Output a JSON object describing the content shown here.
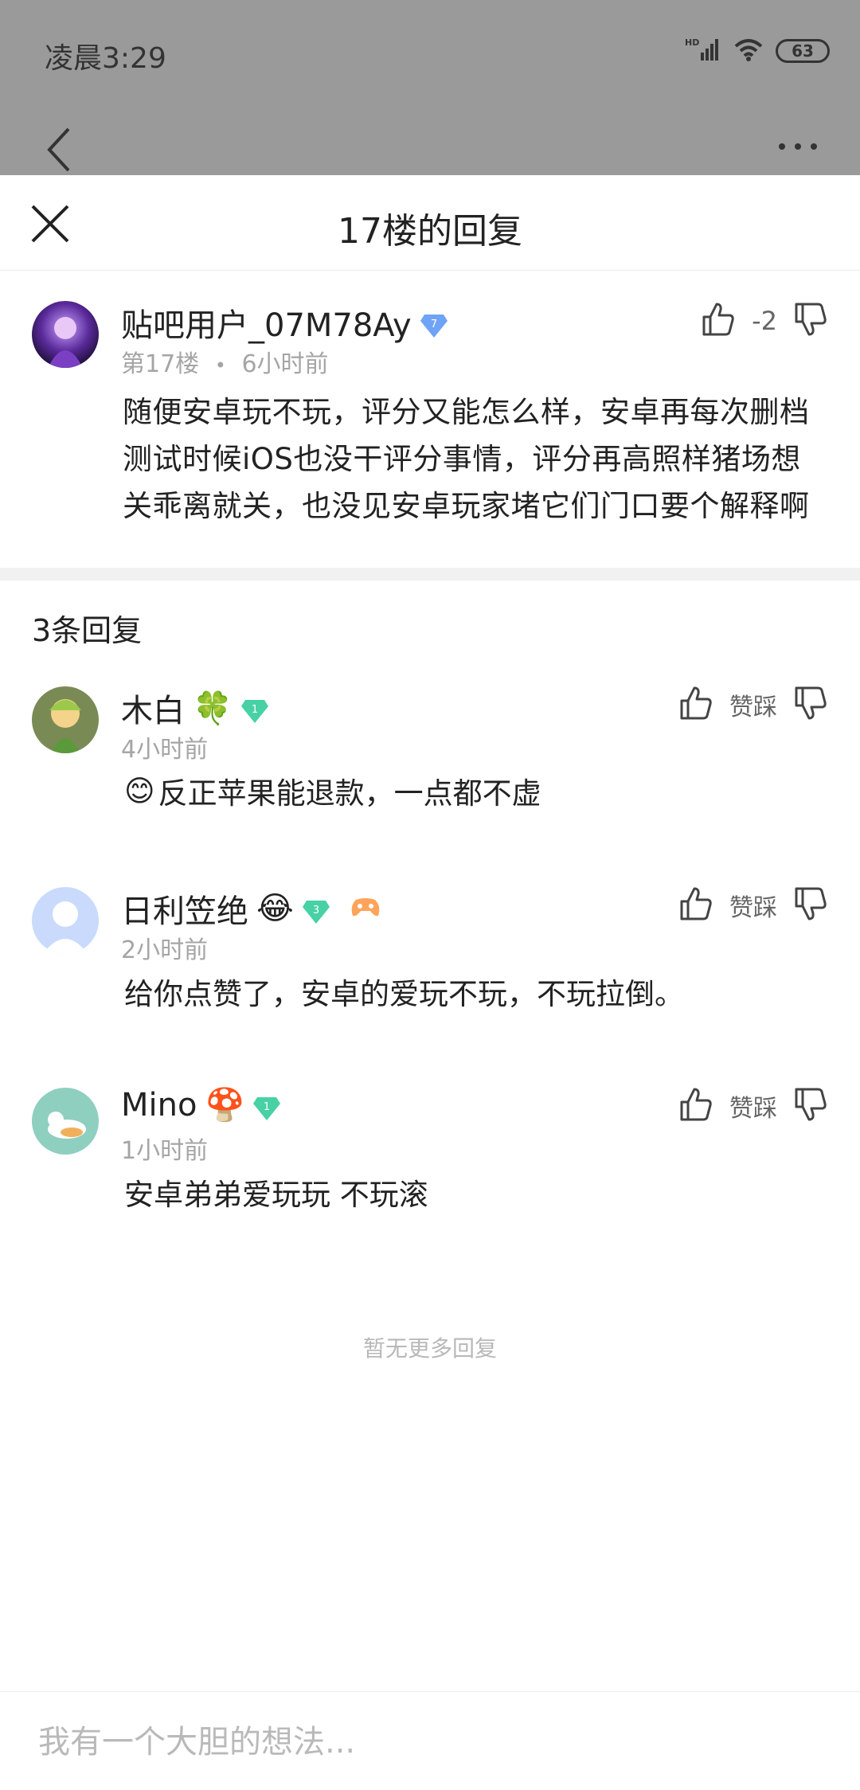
{
  "status_bar": {
    "time": "凌晨3:29",
    "battery": "63",
    "network": "HD"
  },
  "header": {
    "title": "17楼的回复"
  },
  "post": {
    "username": "贴吧用户_07M78Ay",
    "badge_level": "7",
    "floor": "第17楼",
    "separator": "•",
    "time": "6小时前",
    "vote_count": "-2",
    "body": "随便安卓玩不玩，评分又能怎么样，安卓再每次删档测试时候iOS也没干评分事情，评分再高照样猪场想关乖离就关，也没见安卓玩家堵它们门口要个解释啊"
  },
  "replies_heading": "3条回复",
  "replies": [
    {
      "username": "木白",
      "emoji": "🍀",
      "level": "1",
      "time": "4小时前",
      "vote_label": "赞踩",
      "lead_emoji": "😊",
      "body": "反正苹果能退款，一点都不虚"
    },
    {
      "username": "日利笠绝",
      "emoji": "😂",
      "level": "3",
      "time": "2小时前",
      "vote_label": "赞踩",
      "lead_emoji": "",
      "body": "给你点赞了，安卓的爱玩不玩，不玩拉倒。"
    },
    {
      "username": "Mino",
      "emoji": "🍄",
      "level": "1",
      "time": "1小时前",
      "vote_label": "赞踩",
      "lead_emoji": "",
      "body": "安卓弟弟爱玩玩 不玩滚"
    }
  ],
  "end_note": "暂无更多回复",
  "comment_bar": {
    "placeholder": "我有一个大胆的想法..."
  },
  "colors": {
    "dim": "#9a9a9a",
    "badge_blue": "#6fa3f5",
    "badge_green": "#47d1a5",
    "meta_gray": "#a5a5a5"
  }
}
